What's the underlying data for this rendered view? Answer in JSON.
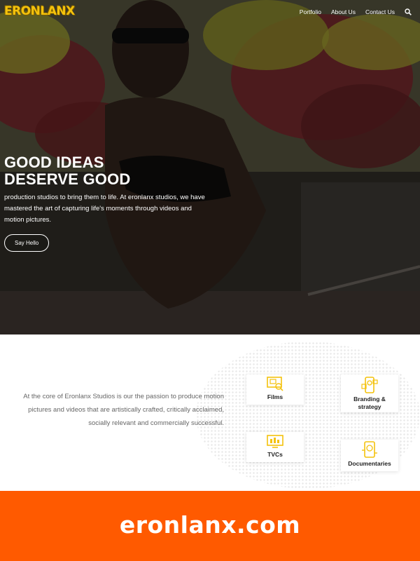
{
  "brand": {
    "logo_text": "ERONLANX",
    "logo_color": "#f4c20d"
  },
  "nav": {
    "items": [
      {
        "label": "Portfolio"
      },
      {
        "label": "About Us"
      },
      {
        "label": "Contact Us"
      }
    ],
    "search_icon": "search-icon"
  },
  "hero": {
    "title_line1": "GOOD IDEAS",
    "title_line2": "DESERVE GOOD",
    "text": "production studios to bring them to life. At eronlanx studios, we have mastered the art of capturing life's moments through videos and motion pictures.",
    "cta_label": "Say Hello"
  },
  "services": {
    "intro": "At the core of Eronlanx Studios is our the passion to produce motion pictures and videos that are artistically crafted, critically acclaimed, socially relevant and commercially successful.",
    "cards": [
      {
        "label": "Films",
        "icon": "film-icon"
      },
      {
        "label": "Branding & strategy",
        "icon": "branding-icon"
      },
      {
        "label": "TVCs",
        "icon": "tv-icon"
      },
      {
        "label": "Documentaries",
        "icon": "documentary-icon"
      }
    ],
    "icon_color": "#f4c20d"
  },
  "banner": {
    "text": "eronlanx.com",
    "color": "#ff5a00"
  }
}
